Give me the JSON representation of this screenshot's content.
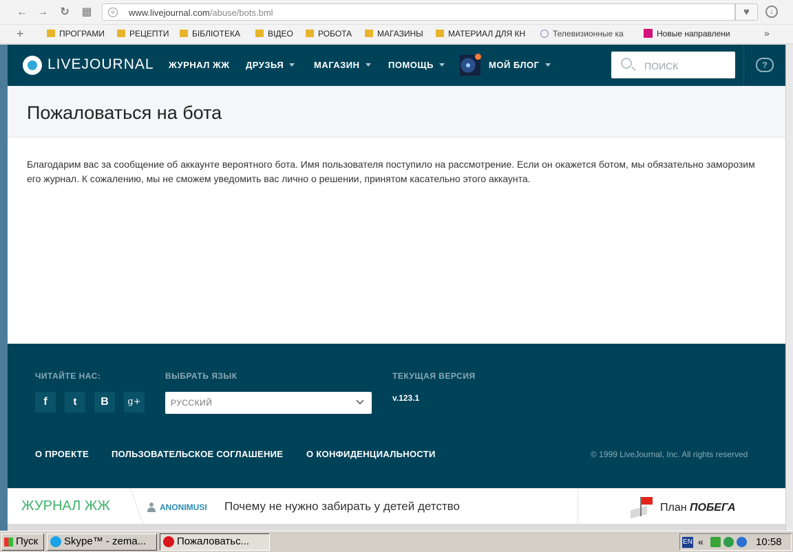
{
  "browser": {
    "url_domain": "www.livejournal.com",
    "url_path": "/abuse/bots.bml"
  },
  "bookmarks": [
    {
      "label": "ПРОГРАМИ",
      "icon": "folder-icon"
    },
    {
      "label": "РЕЦЕПТИ",
      "icon": "folder-icon"
    },
    {
      "label": "БІБЛІОТЕКА",
      "icon": "folder-icon"
    },
    {
      "label": "ВІДЕО",
      "icon": "folder-icon"
    },
    {
      "label": "РОБОТА",
      "icon": "folder-icon"
    },
    {
      "label": "МАГАЗИНЫ",
      "icon": "folder-icon"
    },
    {
      "label": "МАТЕРИАЛ ДЛЯ КН",
      "icon": "folder-icon"
    },
    {
      "label": "Телевизионные ка",
      "icon": "tv-icon"
    },
    {
      "label": "Новые направлени",
      "icon": "site-icon"
    }
  ],
  "header": {
    "logo": "LIVEJOURNAL",
    "nav": [
      "ЖУРНАЛ ЖЖ",
      "ДРУЗЬЯ",
      "МАГАЗИН",
      "ПОМОЩЬ",
      "МОЙ БЛОГ"
    ],
    "search_placeholder": "ПОИСК"
  },
  "page": {
    "title": "Пожаловаться на бота",
    "message": "Благодарим вас за сообщение об аккаунте вероятного бота. Имя пользователя поступило на рассмотрение. Если он окажется ботом, мы обязательно заморозим его журнал. К сожалению, мы не сможем уведомить вас лично о решении, принятом касательно этого аккаунта."
  },
  "footer": {
    "follow_label": "ЧИТАЙТЕ НАС:",
    "social": [
      "f",
      "t",
      "В",
      "g+"
    ],
    "language_label": "ВЫБРАТЬ ЯЗЫК",
    "language_value": "РУССКИЙ",
    "version_label": "ТЕКУЩАЯ ВЕРСИЯ",
    "version_value": "v.123.1",
    "links": [
      "О ПРОЕКТЕ",
      "ПОЛЬЗОВАТЕЛЬСКОЕ СОГЛАШЕНИЕ",
      "О КОНФИДЕНЦИАЛЬНОСТИ"
    ],
    "copyright": "© 1999 LiveJournal, Inc. All rights reserved"
  },
  "promo": {
    "brand": "ЖУРНАЛ ЖЖ",
    "user": "ANONIMUSI",
    "headline": "Почему не нужно забирать у детей детство",
    "partner_plain": "План ",
    "partner_bold": "ПОБЕГА"
  },
  "taskbar": {
    "start": "Пуск",
    "tasks": [
      "Skype™ - zema...",
      "Пожаловатьс..."
    ],
    "lang": "EN",
    "arrow": "«",
    "clock": "10:58"
  }
}
